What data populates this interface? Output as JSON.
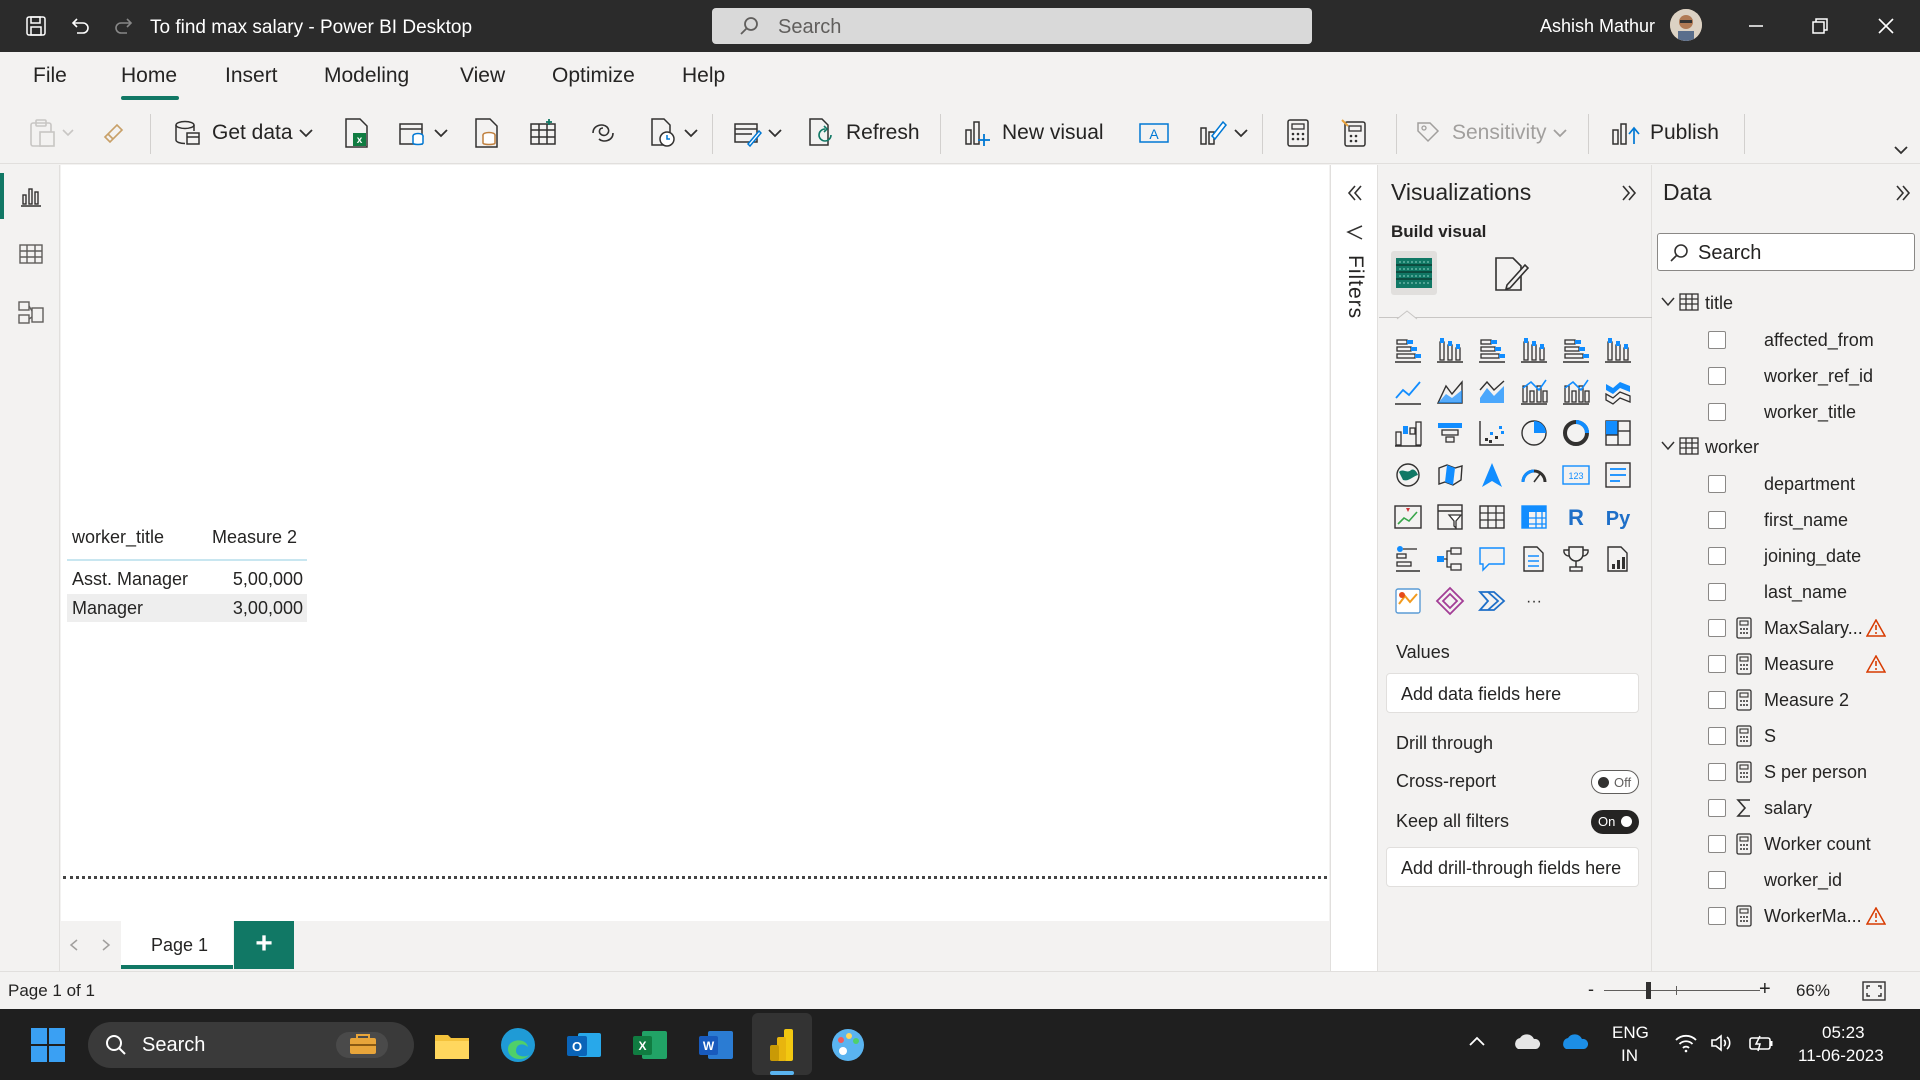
{
  "window": {
    "title": "To find max salary - Power BI Desktop",
    "search_placeholder": "Search",
    "user_name": "Ashish Mathur"
  },
  "menu": {
    "tabs": [
      "File",
      "Home",
      "Insert",
      "Modeling",
      "View",
      "Optimize",
      "Help"
    ],
    "active": "Home"
  },
  "ribbon": {
    "get_data": "Get data",
    "refresh": "Refresh",
    "new_visual": "New visual",
    "sensitivity": "Sensitivity",
    "publish": "Publish"
  },
  "canvas": {
    "table": {
      "headers": [
        "worker_title",
        "Measure 2"
      ],
      "rows": [
        [
          "Asst. Manager",
          "5,00,000"
        ],
        [
          "Manager",
          "3,00,000"
        ]
      ]
    }
  },
  "filters": {
    "label": "Filters"
  },
  "visualizations": {
    "title": "Visualizations",
    "build_visual": "Build visual",
    "values_label": "Values",
    "values_placeholder": "Add data fields here",
    "drill_through_label": "Drill through",
    "cross_report_label": "Cross-report",
    "cross_report_state": "Off",
    "keep_all_filters_label": "Keep all filters",
    "keep_all_filters_state": "On",
    "drill_placeholder": "Add drill-through fields here",
    "r_label": "R",
    "py_label": "Py",
    "more_label": "···"
  },
  "data_pane": {
    "title": "Data",
    "search_placeholder": "Search",
    "tables": [
      {
        "name": "title",
        "fields": [
          "affected_from",
          "worker_ref_id",
          "worker_title"
        ]
      },
      {
        "name": "worker",
        "fields": [
          "department",
          "first_name",
          "joining_date",
          "last_name",
          "MaxSalary...",
          "Measure",
          "Measure 2",
          "S",
          "S per person",
          "salary",
          "Worker count",
          "worker_id",
          "WorkerMa..."
        ]
      }
    ]
  },
  "pages": {
    "tabs": [
      "Page 1"
    ],
    "add_label": "+"
  },
  "status": {
    "page": "Page 1 of 1",
    "zoom": "66%",
    "zoom_minus": "-",
    "zoom_plus": "+"
  },
  "taskbar": {
    "search_placeholder": "Search",
    "language": "ENG",
    "region": "IN",
    "time": "05:23",
    "date": "11-06-2023"
  },
  "colors": {
    "accent": "#117865",
    "warning": "#d83b01"
  }
}
